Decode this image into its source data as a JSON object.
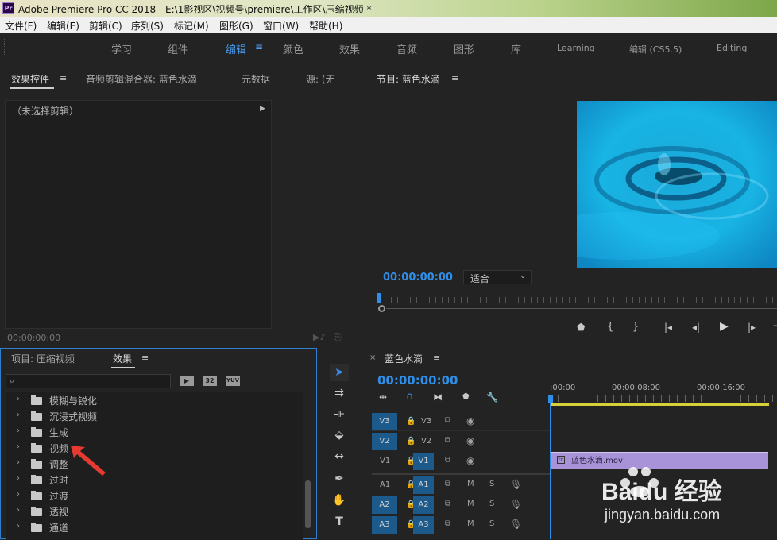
{
  "window": {
    "app_icon": "Pr",
    "title": "Adobe Premiere Pro CC 2018 - E:\\1影视区\\视频号\\premiere\\工作区\\压缩视频 *"
  },
  "menu": [
    "文件(F)",
    "编辑(E)",
    "剪辑(C)",
    "序列(S)",
    "标记(M)",
    "图形(G)",
    "窗口(W)",
    "帮助(H)"
  ],
  "workspaces": [
    "学习",
    "组件",
    "编辑",
    "颜色",
    "效果",
    "音频",
    "图形",
    "库",
    "Learning",
    "编辑 (CS5.5)",
    "Editing"
  ],
  "active_workspace": "编辑",
  "source_panel": {
    "tabs": [
      "效果控件",
      "音频剪辑混合器: 蓝色水滴",
      "元数据",
      "源: (无"
    ],
    "no_clip": "（未选择剪辑）",
    "timecode": "00:00:00:00"
  },
  "program": {
    "tab": "节目: 蓝色水滴",
    "timecode": "00:00:00:00",
    "fit": "适合"
  },
  "project_panel": {
    "tabs": [
      "项目: 压缩视频",
      "效果"
    ],
    "search_placeholder": "",
    "badges": [
      "32",
      "YUV"
    ],
    "folders": [
      "模糊与锐化",
      "沉浸式视频",
      "生成",
      "视频",
      "调整",
      "过时",
      "过渡",
      "透视",
      "通道"
    ]
  },
  "timeline": {
    "tab": "蓝色水滴",
    "timecode": "00:00:00:00",
    "ruler": [
      ":00:00",
      "00:00:08:00",
      "00:00:16:00"
    ],
    "tracks": [
      {
        "src": "V3",
        "label": "V3",
        "m": "",
        "s": ""
      },
      {
        "src": "V2",
        "label": "V2",
        "m": "",
        "s": ""
      },
      {
        "src": "V1",
        "label": "V1",
        "m": "",
        "s": ""
      },
      {
        "src": "A1",
        "label": "A1",
        "m": "M",
        "s": "S"
      },
      {
        "src": "A2",
        "label": "A2",
        "m": "M",
        "s": "S"
      },
      {
        "src": "A3",
        "label": "A3",
        "m": "M",
        "s": "S"
      }
    ],
    "clip": "蓝色水滴.mov"
  },
  "watermark": {
    "brand": "Baidu 经验",
    "url": "jingyan.baidu.com"
  }
}
